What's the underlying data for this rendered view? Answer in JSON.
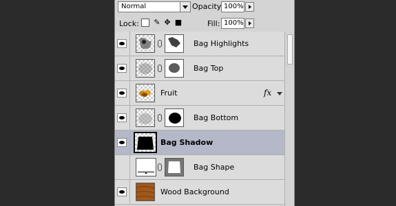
{
  "toolbar": {
    "blend_mode": "Normal",
    "opacity_label": "Opacity:",
    "opacity_value": "100%",
    "lock_label": "Lock:",
    "fill_label": "Fill:",
    "fill_value": "100%"
  },
  "layers": [
    {
      "name": "Bag Highlights",
      "visible": true,
      "has_mask": true,
      "selected": false
    },
    {
      "name": "Bag Top",
      "visible": true,
      "has_mask": true,
      "selected": false
    },
    {
      "name": "Fruit",
      "visible": true,
      "has_mask": false,
      "fx": "fx",
      "selected": false
    },
    {
      "name": "Bag Bottom",
      "visible": true,
      "has_mask": true,
      "selected": false
    },
    {
      "name": "Bag Shadow",
      "visible": true,
      "has_mask": false,
      "selected": true
    },
    {
      "name": "Bag Shape",
      "visible": false,
      "has_mask": true,
      "selected": false
    },
    {
      "name": "Wood Background",
      "visible": true,
      "has_mask": false,
      "selected": false
    }
  ],
  "colors": {
    "selected_row": "#b4b8c8",
    "panel_bg": "#d4d4d4",
    "backdrop": "#2b2b2b"
  }
}
